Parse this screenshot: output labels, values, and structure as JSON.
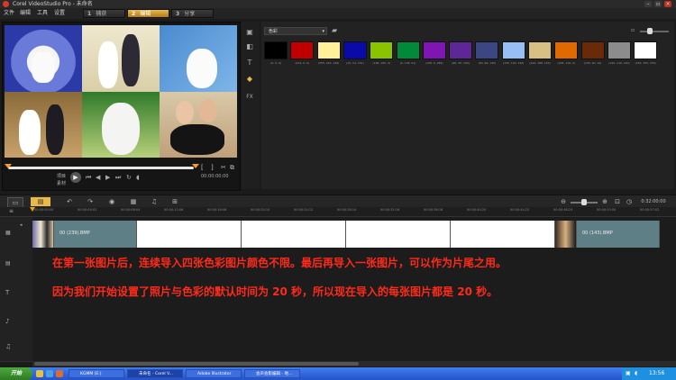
{
  "app": {
    "title": "Corel VideoStudio Pro - 未命名"
  },
  "menu": [
    "文件",
    "编辑",
    "工具",
    "设置"
  ],
  "steps": [
    {
      "num": "1",
      "label": "捕获"
    },
    {
      "num": "2",
      "label": "编辑"
    },
    {
      "num": "3",
      "label": "分享"
    }
  ],
  "preview": {
    "mode_project": "项目",
    "mode_clip": "素材",
    "timecode": "00:00:00:00"
  },
  "library": {
    "category": "色彩",
    "swatches": [
      {
        "color": "#000000",
        "label": "(0, 0, 0)"
      },
      {
        "color": "#c00000",
        "label": "(214, 0, 0)"
      },
      {
        "color": "#fff099",
        "label": "(255, 243, 148)"
      },
      {
        "color": "#0a0aa8",
        "label": "(15, 14, 132)"
      },
      {
        "color": "#8ac300",
        "label": "(138, 195, 0)"
      },
      {
        "color": "#008a3a",
        "label": "(0, 138, 51)"
      },
      {
        "color": "#7f16b4",
        "label": "(128, 0, 186)"
      },
      {
        "color": "#5e2696",
        "label": "(90, 35, 140)"
      },
      {
        "color": "#3b4682",
        "label": "(60, 69, 130)"
      },
      {
        "color": "#97bff5",
        "label": "(155, 190, 240)"
      },
      {
        "color": "#d8c084",
        "label": "(216, 188, 130)"
      },
      {
        "color": "#e06a00",
        "label": "(225, 110, 0)"
      },
      {
        "color": "#6a2a0a",
        "label": "(105, 40, 10)"
      },
      {
        "color": "#8c8c8c",
        "label": "(140, 140, 140)"
      },
      {
        "color": "#ffffff",
        "label": "(255, 255, 255)"
      }
    ]
  },
  "timeline": {
    "total_time": "0:32:00:00",
    "ruler_ticks": [
      "00:00:00:00",
      "00:00:04:02",
      "00:00:08:04",
      "00:00:12:06",
      "00:00:16:08",
      "00:00:20:10",
      "00:00:24:12",
      "00:00:28:14",
      "00:00:32:16",
      "00:00:36:18",
      "00:00:40:20",
      "00:00:44:22",
      "00:00:48:24",
      "00:00:53:00",
      "00:00:57:02"
    ],
    "clips": [
      {
        "label": "00 (239).BMP"
      },
      {
        "label": "00 (143).BMP"
      }
    ],
    "annotation_line1": "在第一张图片后，连续导入四张色彩图片颜色不限。最后再导入一张图片，可以作为片尾之用。",
    "annotation_line2": "因为我们开始设置了照片与色彩的默认时间为 20 秒，所以现在导入的每张图片都是 20 秒。"
  },
  "taskbar": {
    "start": "开始",
    "tasks": [
      "KGMM (E:)",
      "未命名 - Corel V...",
      "Adobe Illustrator",
      "会声会影编辑 - 地..."
    ],
    "clock": "13:56"
  },
  "colors": {
    "accent": "#e8b94a",
    "annotation": "#ff2a1a",
    "clip_teal": "#5e7f86"
  }
}
